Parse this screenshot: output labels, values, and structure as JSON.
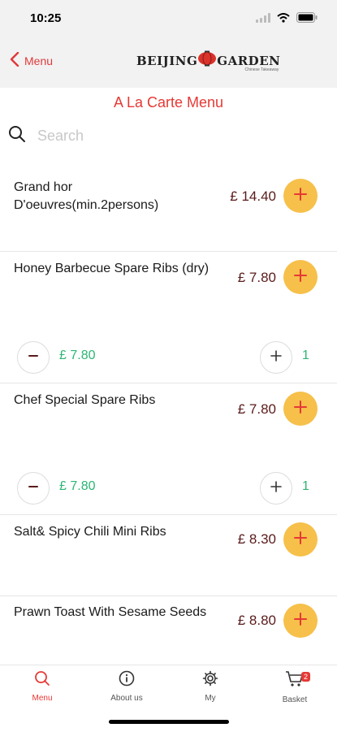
{
  "status": {
    "time": "10:25"
  },
  "nav": {
    "back_label": "Menu",
    "logo_left": "BEIJING",
    "logo_right": "GARDEN",
    "logo_sub": "Chinese Takeaway"
  },
  "page": {
    "title": "A La Carte Menu"
  },
  "search": {
    "placeholder": "Search",
    "value": ""
  },
  "items": [
    {
      "name": "Grand hor D'oeuvres(min.2persons)",
      "price": "£ 14.40"
    },
    {
      "name": "Honey Barbecue Spare Ribs (dry)",
      "price": "£ 7.80",
      "cart_price": "£ 7.80",
      "qty": "1"
    },
    {
      "name": "Chef Special Spare Ribs",
      "price": "£ 7.80",
      "cart_price": "£ 7.80",
      "qty": "1"
    },
    {
      "name": "Salt& Spicy Chili Mini Ribs",
      "price": "£ 8.30"
    },
    {
      "name": "Prawn Toast With Sesame Seeds",
      "price": "£ 8.80"
    }
  ],
  "tabs": [
    {
      "label": "Menu",
      "icon": "search-icon",
      "active": true
    },
    {
      "label": "About us",
      "icon": "info-icon"
    },
    {
      "label": "My",
      "icon": "gear-icon"
    },
    {
      "label": "Basket",
      "icon": "cart-icon",
      "badge": "2"
    }
  ],
  "colors": {
    "accent": "#e53935",
    "add_button": "#f6c04a",
    "price": "#5a1a1a",
    "cart_green": "#2bb673"
  }
}
